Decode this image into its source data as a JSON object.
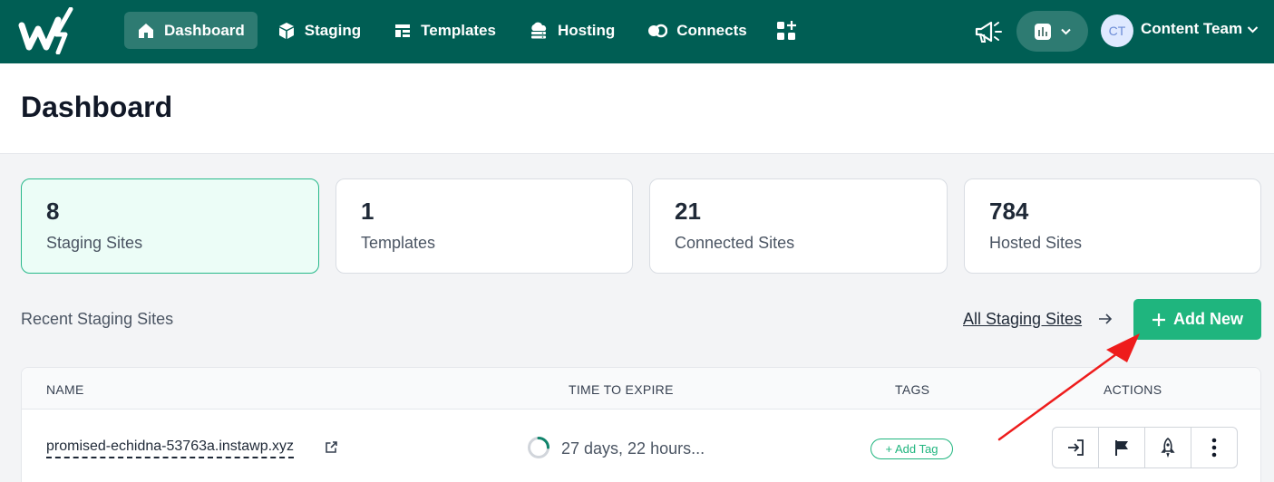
{
  "nav": {
    "items": [
      {
        "label": "Dashboard",
        "icon": "home-icon",
        "active": true
      },
      {
        "label": "Staging",
        "icon": "cube-icon",
        "active": false
      },
      {
        "label": "Templates",
        "icon": "layout-icon",
        "active": false
      },
      {
        "label": "Hosting",
        "icon": "cloud-server-icon",
        "active": false
      },
      {
        "label": "Connects",
        "icon": "connect-icon",
        "active": false
      }
    ],
    "user": {
      "initials": "CT",
      "name": "Content Team"
    }
  },
  "page": {
    "title": "Dashboard"
  },
  "stats": [
    {
      "value": "8",
      "label": "Staging Sites",
      "active": true
    },
    {
      "value": "1",
      "label": "Templates",
      "active": false
    },
    {
      "value": "21",
      "label": "Connected Sites",
      "active": false
    },
    {
      "value": "784",
      "label": "Hosted Sites",
      "active": false
    }
  ],
  "recent": {
    "label": "Recent Staging Sites",
    "all_link": "All Staging Sites",
    "add_button": "Add New"
  },
  "table": {
    "headers": {
      "name": "NAME",
      "expire": "TIME TO EXPIRE",
      "tags": "TAGS",
      "actions": "ACTIONS"
    },
    "rows": [
      {
        "name": "promised-echidna-53763a.instawp.xyz",
        "expire": "27 days, 22 hours...",
        "tag_button": "+ Add Tag"
      }
    ]
  },
  "colors": {
    "brand": "#005e54",
    "accent": "#1fb57e",
    "annotation": "#ee1c1c"
  }
}
